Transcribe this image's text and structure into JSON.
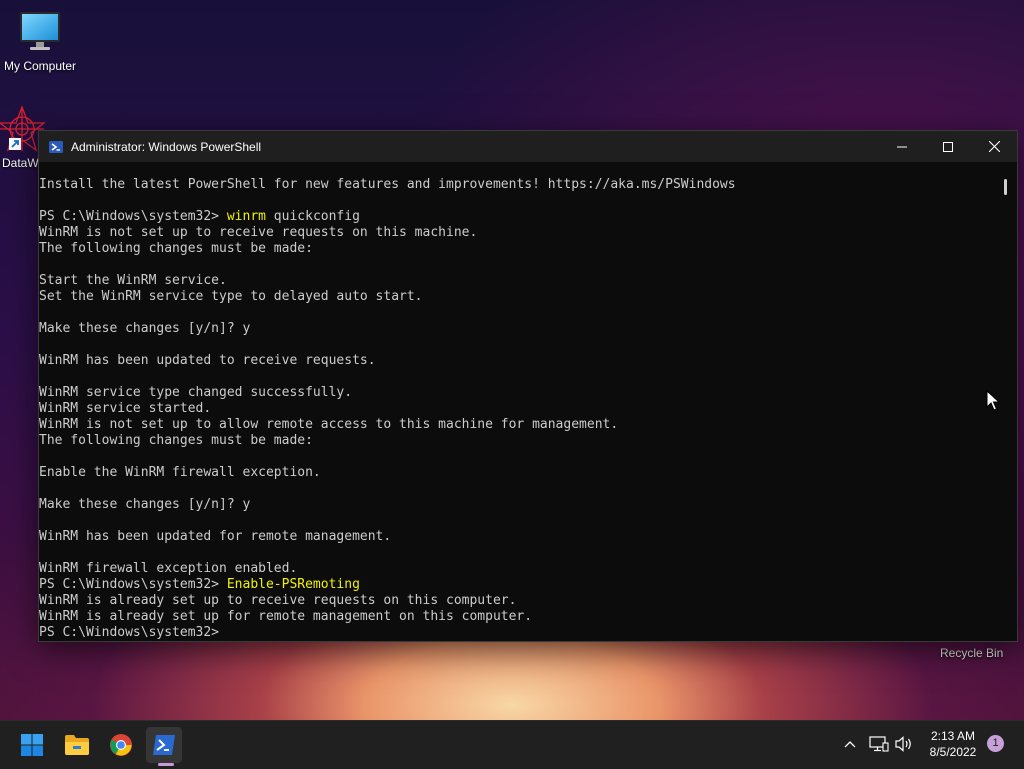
{
  "desktop": {
    "icons": [
      {
        "label": "My Computer"
      },
      {
        "label": "DataW"
      }
    ],
    "recycle_bin_label": "Recycle Bin"
  },
  "window": {
    "title": "Administrator: Windows PowerShell",
    "lines": [
      {
        "text": "Install the latest PowerShell for new features and improvements! https://aka.ms/PSWindows"
      },
      {
        "text": ""
      },
      {
        "prompt": "PS C:\\Windows\\system32> ",
        "cmd": "winrm",
        "rest": " quickconfig"
      },
      {
        "text": "WinRM is not set up to receive requests on this machine."
      },
      {
        "text": "The following changes must be made:"
      },
      {
        "text": ""
      },
      {
        "text": "Start the WinRM service."
      },
      {
        "text": "Set the WinRM service type to delayed auto start."
      },
      {
        "text": ""
      },
      {
        "text": "Make these changes [y/n]? y"
      },
      {
        "text": ""
      },
      {
        "text": "WinRM has been updated to receive requests."
      },
      {
        "text": ""
      },
      {
        "text": "WinRM service type changed successfully."
      },
      {
        "text": "WinRM service started."
      },
      {
        "text": "WinRM is not set up to allow remote access to this machine for management."
      },
      {
        "text": "The following changes must be made:"
      },
      {
        "text": ""
      },
      {
        "text": "Enable the WinRM firewall exception."
      },
      {
        "text": ""
      },
      {
        "text": "Make these changes [y/n]? y"
      },
      {
        "text": ""
      },
      {
        "text": "WinRM has been updated for remote management."
      },
      {
        "text": ""
      },
      {
        "text": "WinRM firewall exception enabled."
      },
      {
        "prompt": "PS C:\\Windows\\system32> ",
        "cmd": "Enable-PSRemoting",
        "rest": ""
      },
      {
        "text": "WinRM is already set up to receive requests on this computer."
      },
      {
        "text": "WinRM is already set up for remote management on this computer."
      },
      {
        "prompt": "PS C:\\Windows\\system32> ",
        "cmd": "",
        "rest": ""
      }
    ]
  },
  "taskbar": {
    "apps": [
      {
        "name": "start",
        "icon": "windows-logo-icon"
      },
      {
        "name": "file-explorer",
        "icon": "folder-icon"
      },
      {
        "name": "chrome",
        "icon": "chrome-icon"
      },
      {
        "name": "powershell",
        "icon": "powershell-icon"
      }
    ],
    "clock": {
      "time": "2:13 AM",
      "date": "8/5/2022"
    },
    "notification_count": "1"
  },
  "colors": {
    "console_bg": "#0c0c0c",
    "console_text": "#cccccc",
    "command_text": "#f2f200",
    "titlebar_bg": "#1f1f1f",
    "taskbar_bg": "#202020"
  }
}
